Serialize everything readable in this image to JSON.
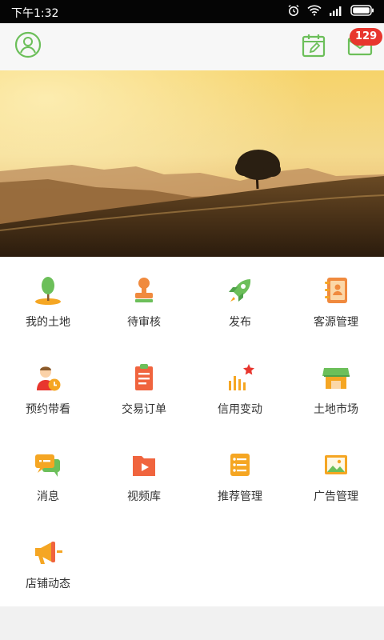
{
  "status_bar": {
    "time": "下午1:32"
  },
  "header": {
    "message_badge": "129"
  },
  "menu": [
    {
      "label": "我的土地",
      "icon": "sapling-icon"
    },
    {
      "label": "待审核",
      "icon": "stamp-icon"
    },
    {
      "label": "发布",
      "icon": "rocket-icon"
    },
    {
      "label": "客源管理",
      "icon": "contact-book-icon"
    },
    {
      "label": "预约带看",
      "icon": "person-clock-icon"
    },
    {
      "label": "交易订单",
      "icon": "clipboard-icon"
    },
    {
      "label": "信用变动",
      "icon": "bar-chart-star-icon"
    },
    {
      "label": "土地市场",
      "icon": "store-icon"
    },
    {
      "label": "消息",
      "icon": "chat-bubbles-icon"
    },
    {
      "label": "视频库",
      "icon": "video-folder-icon"
    },
    {
      "label": "推荐管理",
      "icon": "list-icon"
    },
    {
      "label": "广告管理",
      "icon": "billboard-icon"
    },
    {
      "label": "店铺动态",
      "icon": "megaphone-icon"
    }
  ],
  "colors": {
    "green": "#6cbf5a",
    "orange": "#f5a623",
    "red": "#e8362e"
  }
}
